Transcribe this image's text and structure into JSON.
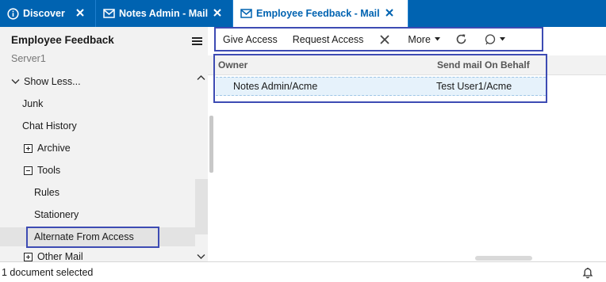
{
  "tabs": [
    {
      "label": "Discover",
      "icon": "info-icon"
    },
    {
      "label": "Notes Admin - Mail",
      "icon": "mail-icon"
    },
    {
      "label": "Employee Feedback - Mail",
      "icon": "mail-icon"
    }
  ],
  "sidebar": {
    "title": "Employee Feedback",
    "server": "Server1",
    "items": [
      {
        "label": "Show Less..."
      },
      {
        "label": "Junk"
      },
      {
        "label": "Chat History"
      },
      {
        "label": "Archive"
      },
      {
        "label": "Tools"
      },
      {
        "label": "Rules"
      },
      {
        "label": "Stationery"
      },
      {
        "label": "Alternate From Access"
      },
      {
        "label": "Other Mail"
      }
    ]
  },
  "toolbar": {
    "give_access": "Give Access",
    "request_access": "Request Access",
    "more": "More"
  },
  "grid": {
    "columns": [
      "Owner",
      "Send mail On Behalf"
    ],
    "rows": [
      {
        "owner": "Notes Admin/Acme",
        "send_mail_on_behalf": "Test User1/Acme"
      }
    ]
  },
  "status": {
    "text": "1 document selected"
  },
  "colors": {
    "tabbar": "#0063b1",
    "highlight_border": "#3d4bb3",
    "sidebar_bg": "#f2f2f2",
    "selected_row": "#e6f2fb"
  }
}
